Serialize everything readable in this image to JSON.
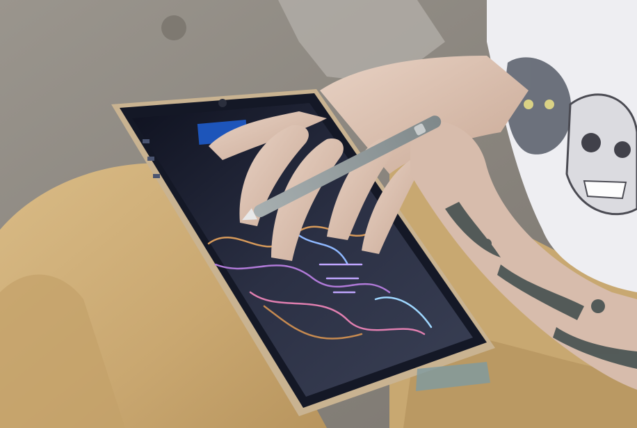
{
  "caption": "",
  "photo": {
    "subject": "person-drawing-on-tablet-with-stylus",
    "palette": {
      "ground": "#8f8a82",
      "pants": "#cfae78",
      "pants_shadow": "#a98a58",
      "skin": "#dcc2b2",
      "tablet_bezel": "#c7b291",
      "tablet_screen": "#1d2233",
      "stylus": "#8c9596",
      "shirt": "#eeeef2",
      "tattoo": "#3c4a4a"
    }
  }
}
